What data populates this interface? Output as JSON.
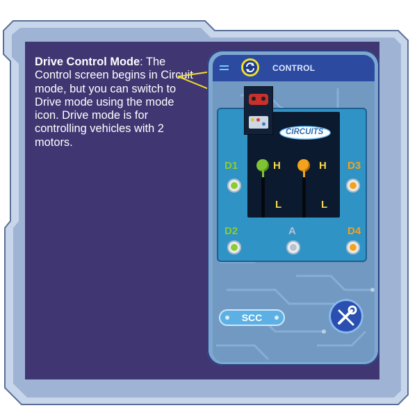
{
  "description": {
    "title": "Drive Control Mode",
    "body": ": The Control screen begins in Circuit mode, but you can switch to Drive mode using the mode icon. Drive mode is for controlling vehicles with 2 motors."
  },
  "app": {
    "topbar_title": "CONTROL",
    "logo_text": "CIRCUITS",
    "scc_label": "SCC"
  },
  "board": {
    "ports": [
      {
        "id": "d1",
        "label": "D1",
        "color": "#8ccc2e"
      },
      {
        "id": "d3",
        "label": "D3",
        "color": "#f3a31b"
      },
      {
        "id": "d2",
        "label": "D2",
        "color": "#8ccc2e"
      },
      {
        "id": "a",
        "label": "A",
        "color": "#b7c2cf"
      },
      {
        "id": "d4",
        "label": "D4",
        "color": "#f3a31b"
      }
    ],
    "levers": [
      {
        "high": "H",
        "low": "L",
        "knob_color": "#7fc234"
      },
      {
        "high": "H",
        "low": "L",
        "knob_color": "#f3a31b"
      }
    ]
  },
  "icons": {
    "menu": "hamburger-icon",
    "mode": "refresh-mode-icon",
    "tools": "wrench-screwdriver-icon",
    "vehicle": "car-icon",
    "circuit": "circuit-board-icon"
  },
  "colors": {
    "panel": "#403672",
    "accent": "#f2df2a",
    "topbar": "#2b4aa0"
  }
}
